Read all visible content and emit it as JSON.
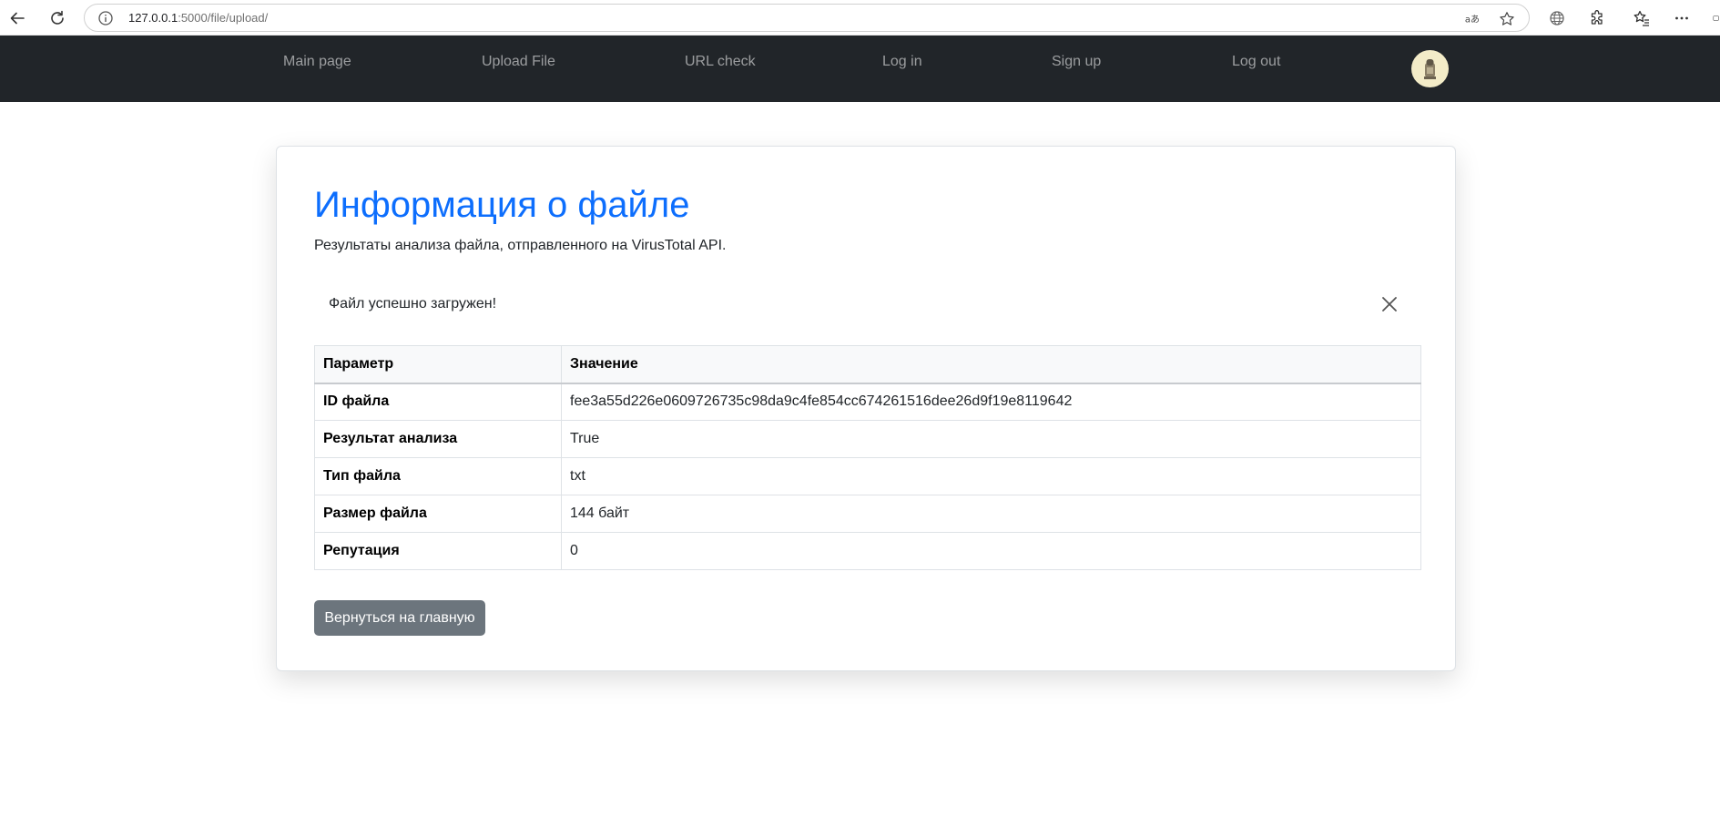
{
  "browser": {
    "url_host": "127.0.0.1",
    "url_path": ":5000/file/upload/"
  },
  "nav": {
    "items": [
      {
        "label": "Main page"
      },
      {
        "label": "Upload File"
      },
      {
        "label": "URL check"
      },
      {
        "label": "Log in"
      },
      {
        "label": "Sign up"
      },
      {
        "label": "Log out"
      }
    ]
  },
  "main": {
    "title": "Информация о файле",
    "lead": "Результаты анализа файла, отправленного на VirusTotal API.",
    "alert": "Файл успешно загружен!",
    "table": {
      "headers": [
        "Параметр",
        "Значение"
      ],
      "rows": [
        [
          "ID файла",
          "fee3a55d226e0609726735c98da9c4fe854cc674261516dee26d9f19e8119642"
        ],
        [
          "Результат анализа",
          "True"
        ],
        [
          "Тип файла",
          "txt"
        ],
        [
          "Размер файла",
          "144 байт"
        ],
        [
          "Репутация",
          "0"
        ]
      ]
    },
    "back_button": "Вернуться на главную"
  },
  "colors": {
    "navbar_bg": "#212529",
    "title_blue": "#0d6efd",
    "button_gray": "#6c757d"
  }
}
